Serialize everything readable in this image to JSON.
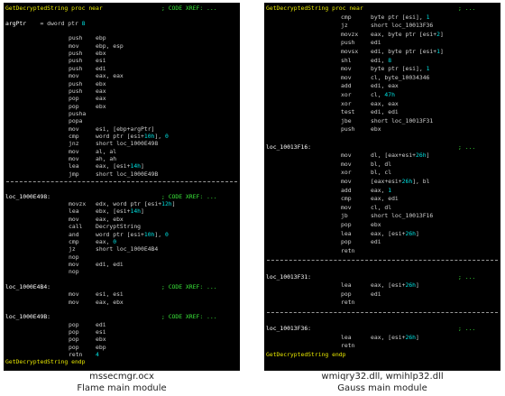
{
  "left_panel": {
    "caption_file": "mssecmgr.ocx",
    "caption_desc": "Flame main module",
    "lines": [
      {
        "label": "GetDecryptedString proc near",
        "comment": "; CODE XREF: ..."
      },
      {
        "label": ""
      },
      {
        "label": "argPtr",
        "op": "= dword ptr",
        "args": "8"
      },
      {
        "label": ""
      },
      {
        "op": "push",
        "args": "ebp"
      },
      {
        "op": "mov",
        "args": "ebp, esp"
      },
      {
        "op": "push",
        "args": "ebx"
      },
      {
        "op": "push",
        "args": "esi"
      },
      {
        "op": "push",
        "args": "edi"
      },
      {
        "op": "mov",
        "args": "eax, eax"
      },
      {
        "op": "push",
        "args": "ebx"
      },
      {
        "op": "push",
        "args": "eax"
      },
      {
        "op": "pop",
        "args": "eax"
      },
      {
        "op": "pop",
        "args": "ebx"
      },
      {
        "op": "pusha",
        "args": ""
      },
      {
        "op": "popa",
        "args": ""
      },
      {
        "op": "mov",
        "args": "esi, [ebp+argPtr]"
      },
      {
        "op": "cmp",
        "args": "word ptr [esi+10h], 0"
      },
      {
        "op": "jnz",
        "args": "short loc_1000E498"
      },
      {
        "op": "mov",
        "args": "al, al"
      },
      {
        "op": "mov",
        "args": "ah, ah"
      },
      {
        "op": "lea",
        "args": "eax, [esi+14h]"
      },
      {
        "op": "jmp",
        "args": "short loc_1000E49B"
      },
      {
        "sep": true
      },
      {
        "label": ""
      },
      {
        "label": "loc_1000E498:",
        "comment": "; CODE XREF: ..."
      },
      {
        "op": "movzx",
        "args": "edx, word ptr [esi+12h]"
      },
      {
        "op": "lea",
        "args": "ebx, [esi+14h]"
      },
      {
        "op": "mov",
        "args": "eax, ebx"
      },
      {
        "op": "call",
        "args": "DecryptString"
      },
      {
        "op": "and",
        "args": "word ptr [esi+10h], 0"
      },
      {
        "op": "cmp",
        "args": "eax, 0"
      },
      {
        "op": "jz",
        "args": "short loc_1000E4B4"
      },
      {
        "op": "nop",
        "args": ""
      },
      {
        "op": "mov",
        "args": "edi, edi"
      },
      {
        "op": "nop",
        "args": ""
      },
      {
        "label": ""
      },
      {
        "label": "loc_1000E4B4:",
        "comment": "; CODE XREF: ..."
      },
      {
        "op": "mov",
        "args": "esi, esi"
      },
      {
        "op": "mov",
        "args": "eax, ebx"
      },
      {
        "label": ""
      },
      {
        "label": "loc_1000E49B:",
        "comment": "; CODE XREF: ..."
      },
      {
        "op": "pop",
        "args": "edi"
      },
      {
        "op": "pop",
        "args": "esi"
      },
      {
        "op": "pop",
        "args": "ebx"
      },
      {
        "op": "pop",
        "args": "ebp"
      },
      {
        "op": "retn",
        "args": "4"
      },
      {
        "label": "GetDecryptedString endp"
      }
    ]
  },
  "right_panel": {
    "caption_file": "wmiqry32.dll, wmihlp32.dll",
    "caption_desc": "Gauss main module",
    "lines": [
      {
        "label": "GetDecryptedString proc near",
        "comment": "; ..."
      },
      {
        "op": "cmp",
        "args": "byte ptr [esi], 1"
      },
      {
        "op": "jz",
        "args": "short loc_10013F36"
      },
      {
        "op": "movzx",
        "args": "eax, byte ptr [esi+2]"
      },
      {
        "op": "push",
        "args": "edi"
      },
      {
        "op": "movsx",
        "args": "edi, byte ptr [esi+1]"
      },
      {
        "op": "shl",
        "args": "edi, 8"
      },
      {
        "op": "mov",
        "args": "byte ptr [esi], 1"
      },
      {
        "op": "mov",
        "args": "cl, byte_10034346"
      },
      {
        "op": "add",
        "args": "edi, eax"
      },
      {
        "op": "xor",
        "args": "cl, 47h"
      },
      {
        "op": "xor",
        "args": "eax, eax"
      },
      {
        "op": "test",
        "args": "edi, edi"
      },
      {
        "op": "jbe",
        "args": "short loc_10013F31"
      },
      {
        "op": "push",
        "args": "ebx"
      },
      {
        "label": ""
      },
      {
        "label": "loc_10013F16:",
        "comment": "; ..."
      },
      {
        "op": "mov",
        "args": "dl, [eax+esi+26h]"
      },
      {
        "op": "mov",
        "args": "bl, dl"
      },
      {
        "op": "xor",
        "args": "bl, cl"
      },
      {
        "op": "mov",
        "args": "[eax+esi+26h], bl"
      },
      {
        "op": "add",
        "args": "eax, 1"
      },
      {
        "op": "cmp",
        "args": "eax, edi"
      },
      {
        "op": "mov",
        "args": "cl, dl"
      },
      {
        "op": "jb",
        "args": "short loc_10013F16"
      },
      {
        "op": "pop",
        "args": "ebx"
      },
      {
        "op": "lea",
        "args": "eax, [esi+26h]"
      },
      {
        "op": "pop",
        "args": "edi"
      },
      {
        "op": "retn",
        "args": ""
      },
      {
        "sep": true
      },
      {
        "label": ""
      },
      {
        "label": "loc_10013F31:",
        "comment": "; ..."
      },
      {
        "op": "lea",
        "args": "eax, [esi+26h]"
      },
      {
        "op": "pop",
        "args": "edi"
      },
      {
        "op": "retn",
        "args": ""
      },
      {
        "sep": true
      },
      {
        "label": ""
      },
      {
        "label": "loc_10013F36:",
        "comment": "; ..."
      },
      {
        "op": "lea",
        "args": "eax, [esi+26h]"
      },
      {
        "op": "retn",
        "args": ""
      },
      {
        "label": "GetDecryptedString endp"
      }
    ]
  }
}
